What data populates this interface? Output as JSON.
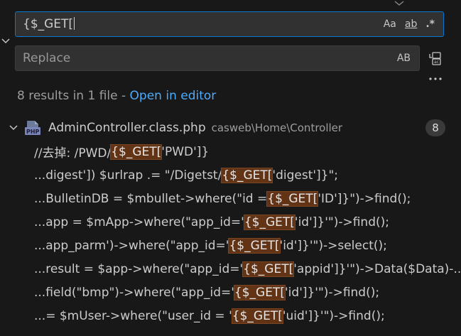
{
  "search": {
    "query": "{$_GET[",
    "options": {
      "match_case": "Aa",
      "whole_word": "ab",
      "regex": ".*"
    }
  },
  "replace": {
    "placeholder": "Replace",
    "preserve_case": "AB"
  },
  "summary": {
    "text": "8 results in 1 file - ",
    "open_editor": "Open in editor"
  },
  "file": {
    "name": "AdminController.class.php",
    "path": "casweb\\Home\\Controller",
    "count": "8"
  },
  "results": [
    {
      "before": "//去掉: /PWD/",
      "match": "{$_GET[",
      "after": "'PWD']}"
    },
    {
      "before": "...digest']) $urlrap .= \"/Digetst/",
      "match": "{$_GET[",
      "after": "'digest']}\";"
    },
    {
      "before": "...BulletinDB = $mbullet->where(\"id = ",
      "match": "{$_GET[",
      "after": "'ID']}\")->find();"
    },
    {
      "before": "...app = $mApp->where(\"app_id='",
      "match": "{$_GET[",
      "after": "'id']}'\")->find();"
    },
    {
      "before": "...app_parm')->where(\"app_id='",
      "match": "{$_GET[",
      "after": "'id']}'\")->select();"
    },
    {
      "before": "...result = $app->where(\"app_id='",
      "match": "{$_GET[",
      "after": "'appid']}'\")->Data($Data)-..."
    },
    {
      "before": "...field(\"bmp\")->where(\"app_id='",
      "match": "{$_GET[",
      "after": "'id']}'\")->find();"
    },
    {
      "before": "...= $mUser->where(\"user_id = '",
      "match": "{$_GET[",
      "after": "'uid']}'\")->find();"
    }
  ]
}
